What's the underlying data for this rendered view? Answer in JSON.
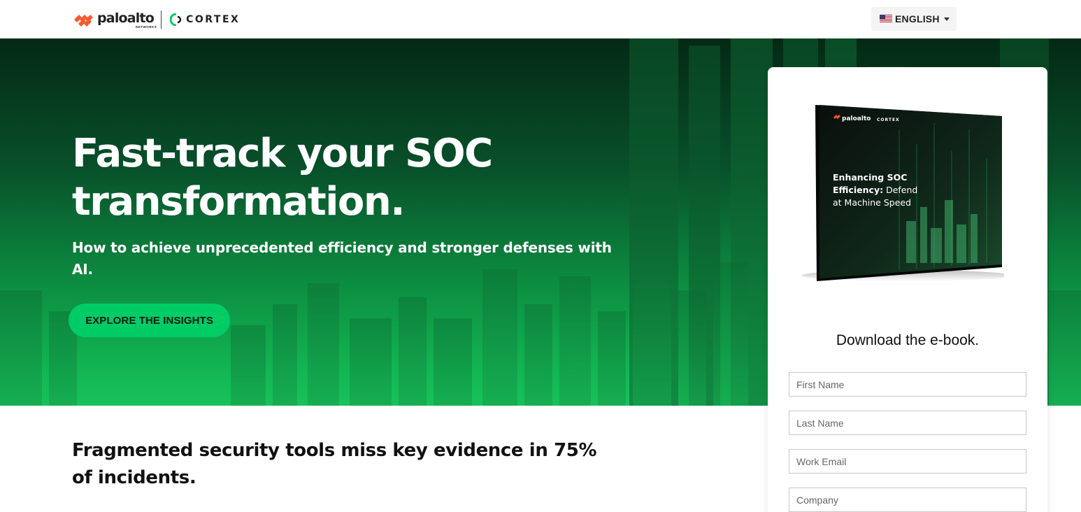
{
  "header": {
    "brand_paloalto": "paloalto",
    "brand_networks": "NETWORKS",
    "brand_cortex": "CORTEX",
    "language_label": "ENGLISH",
    "flag_icon": "us-flag-icon"
  },
  "hero": {
    "title": "Fast-track your SOC transformation.",
    "subtitle": "How to achieve unprecedented efficiency and stronger defenses with AI.",
    "cta_label": "EXPLORE THE INSIGHTS"
  },
  "section": {
    "title": "Fragmented security tools miss key evidence in 75% of incidents."
  },
  "form": {
    "book_brand": "paloalto",
    "book_brand_cortex": "CORTEX",
    "book_title_bold": "Enhancing SOC Efficiency:",
    "book_title_rest": "Defend at Machine Speed",
    "heading": "Download the e-book.",
    "first_name_placeholder": "First Name",
    "last_name_placeholder": "Last Name",
    "work_email_placeholder": "Work Email",
    "company_placeholder": "Company"
  },
  "colors": {
    "brand_orange": "#fa582d",
    "cortex_green": "#00cc66",
    "cta_green": "#00cc66",
    "hero_dark": "#042915"
  }
}
